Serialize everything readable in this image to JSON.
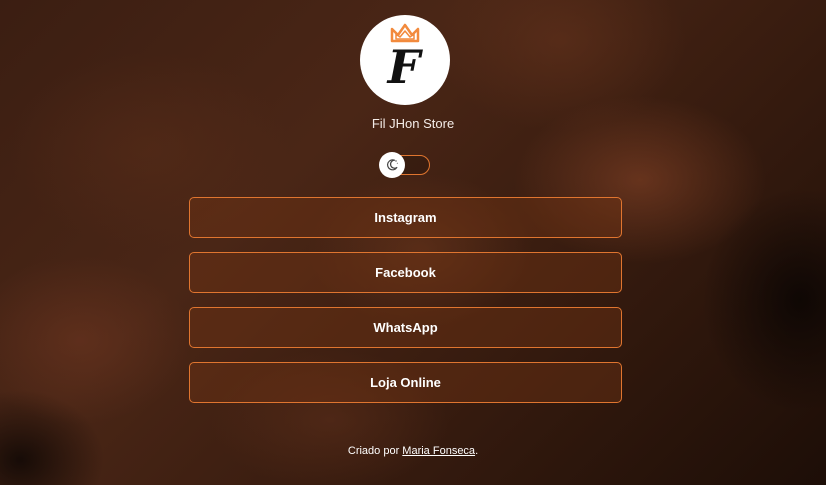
{
  "profile": {
    "logo_letter": "F",
    "name": "Fil JHon Store",
    "logo_icon": "crown-letter-f-logo",
    "accent_color": "#e0752f"
  },
  "theme_toggle": {
    "icon": "moon-icon"
  },
  "links": [
    {
      "label": "Instagram"
    },
    {
      "label": "Facebook"
    },
    {
      "label": "WhatsApp"
    },
    {
      "label": "Loja Online"
    }
  ],
  "footer": {
    "prefix": "Criado por",
    "author": "Maria Fonseca",
    "suffix": "."
  }
}
